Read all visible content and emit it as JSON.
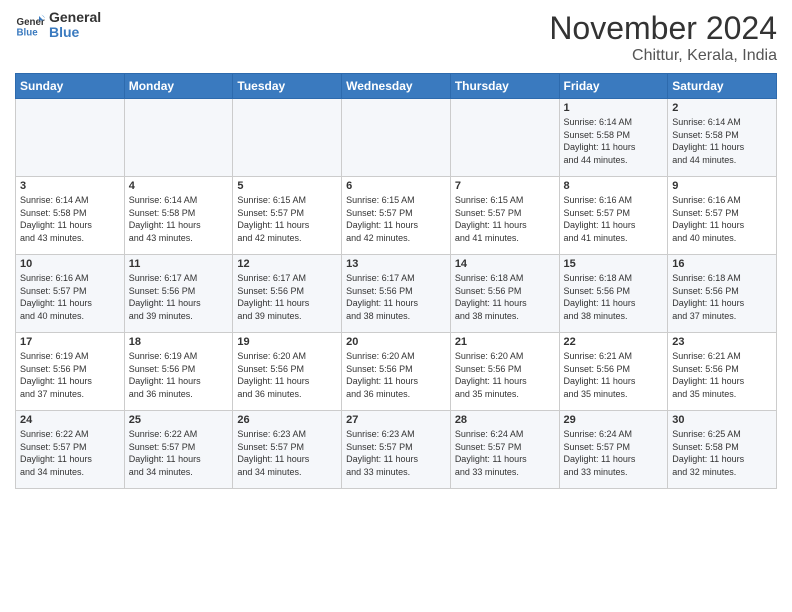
{
  "header": {
    "logo_line1": "General",
    "logo_line2": "Blue",
    "title": "November 2024",
    "location": "Chittur, Kerala, India"
  },
  "weekdays": [
    "Sunday",
    "Monday",
    "Tuesday",
    "Wednesday",
    "Thursday",
    "Friday",
    "Saturday"
  ],
  "weeks": [
    [
      {
        "day": "",
        "info": ""
      },
      {
        "day": "",
        "info": ""
      },
      {
        "day": "",
        "info": ""
      },
      {
        "day": "",
        "info": ""
      },
      {
        "day": "",
        "info": ""
      },
      {
        "day": "1",
        "info": "Sunrise: 6:14 AM\nSunset: 5:58 PM\nDaylight: 11 hours\nand 44 minutes."
      },
      {
        "day": "2",
        "info": "Sunrise: 6:14 AM\nSunset: 5:58 PM\nDaylight: 11 hours\nand 44 minutes."
      }
    ],
    [
      {
        "day": "3",
        "info": "Sunrise: 6:14 AM\nSunset: 5:58 PM\nDaylight: 11 hours\nand 43 minutes."
      },
      {
        "day": "4",
        "info": "Sunrise: 6:14 AM\nSunset: 5:58 PM\nDaylight: 11 hours\nand 43 minutes."
      },
      {
        "day": "5",
        "info": "Sunrise: 6:15 AM\nSunset: 5:57 PM\nDaylight: 11 hours\nand 42 minutes."
      },
      {
        "day": "6",
        "info": "Sunrise: 6:15 AM\nSunset: 5:57 PM\nDaylight: 11 hours\nand 42 minutes."
      },
      {
        "day": "7",
        "info": "Sunrise: 6:15 AM\nSunset: 5:57 PM\nDaylight: 11 hours\nand 41 minutes."
      },
      {
        "day": "8",
        "info": "Sunrise: 6:16 AM\nSunset: 5:57 PM\nDaylight: 11 hours\nand 41 minutes."
      },
      {
        "day": "9",
        "info": "Sunrise: 6:16 AM\nSunset: 5:57 PM\nDaylight: 11 hours\nand 40 minutes."
      }
    ],
    [
      {
        "day": "10",
        "info": "Sunrise: 6:16 AM\nSunset: 5:57 PM\nDaylight: 11 hours\nand 40 minutes."
      },
      {
        "day": "11",
        "info": "Sunrise: 6:17 AM\nSunset: 5:56 PM\nDaylight: 11 hours\nand 39 minutes."
      },
      {
        "day": "12",
        "info": "Sunrise: 6:17 AM\nSunset: 5:56 PM\nDaylight: 11 hours\nand 39 minutes."
      },
      {
        "day": "13",
        "info": "Sunrise: 6:17 AM\nSunset: 5:56 PM\nDaylight: 11 hours\nand 38 minutes."
      },
      {
        "day": "14",
        "info": "Sunrise: 6:18 AM\nSunset: 5:56 PM\nDaylight: 11 hours\nand 38 minutes."
      },
      {
        "day": "15",
        "info": "Sunrise: 6:18 AM\nSunset: 5:56 PM\nDaylight: 11 hours\nand 38 minutes."
      },
      {
        "day": "16",
        "info": "Sunrise: 6:18 AM\nSunset: 5:56 PM\nDaylight: 11 hours\nand 37 minutes."
      }
    ],
    [
      {
        "day": "17",
        "info": "Sunrise: 6:19 AM\nSunset: 5:56 PM\nDaylight: 11 hours\nand 37 minutes."
      },
      {
        "day": "18",
        "info": "Sunrise: 6:19 AM\nSunset: 5:56 PM\nDaylight: 11 hours\nand 36 minutes."
      },
      {
        "day": "19",
        "info": "Sunrise: 6:20 AM\nSunset: 5:56 PM\nDaylight: 11 hours\nand 36 minutes."
      },
      {
        "day": "20",
        "info": "Sunrise: 6:20 AM\nSunset: 5:56 PM\nDaylight: 11 hours\nand 36 minutes."
      },
      {
        "day": "21",
        "info": "Sunrise: 6:20 AM\nSunset: 5:56 PM\nDaylight: 11 hours\nand 35 minutes."
      },
      {
        "day": "22",
        "info": "Sunrise: 6:21 AM\nSunset: 5:56 PM\nDaylight: 11 hours\nand 35 minutes."
      },
      {
        "day": "23",
        "info": "Sunrise: 6:21 AM\nSunset: 5:56 PM\nDaylight: 11 hours\nand 35 minutes."
      }
    ],
    [
      {
        "day": "24",
        "info": "Sunrise: 6:22 AM\nSunset: 5:57 PM\nDaylight: 11 hours\nand 34 minutes."
      },
      {
        "day": "25",
        "info": "Sunrise: 6:22 AM\nSunset: 5:57 PM\nDaylight: 11 hours\nand 34 minutes."
      },
      {
        "day": "26",
        "info": "Sunrise: 6:23 AM\nSunset: 5:57 PM\nDaylight: 11 hours\nand 34 minutes."
      },
      {
        "day": "27",
        "info": "Sunrise: 6:23 AM\nSunset: 5:57 PM\nDaylight: 11 hours\nand 33 minutes."
      },
      {
        "day": "28",
        "info": "Sunrise: 6:24 AM\nSunset: 5:57 PM\nDaylight: 11 hours\nand 33 minutes."
      },
      {
        "day": "29",
        "info": "Sunrise: 6:24 AM\nSunset: 5:57 PM\nDaylight: 11 hours\nand 33 minutes."
      },
      {
        "day": "30",
        "info": "Sunrise: 6:25 AM\nSunset: 5:58 PM\nDaylight: 11 hours\nand 32 minutes."
      }
    ]
  ]
}
